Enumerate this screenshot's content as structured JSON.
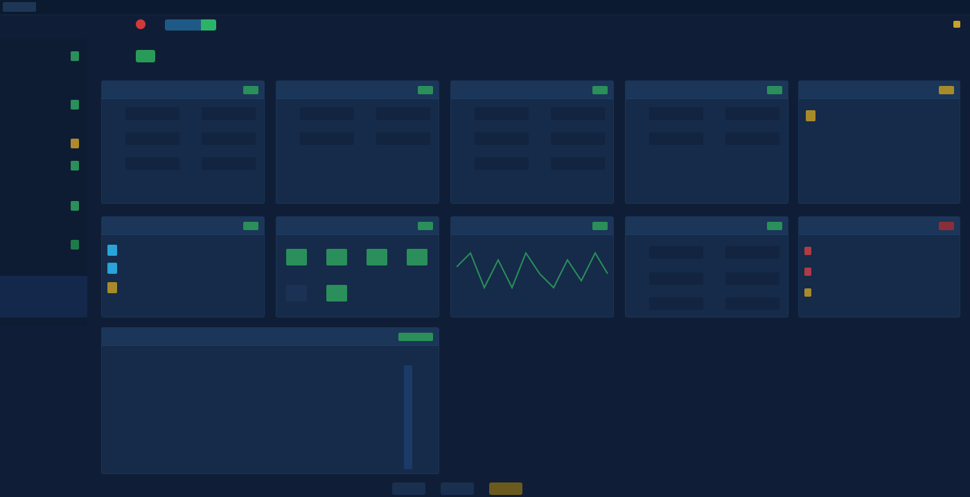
{
  "app": {
    "brand": "",
    "nav": [
      "",
      "",
      ""
    ],
    "top_right": [
      "",
      "",
      ""
    ]
  },
  "subbar": {
    "label_1": "",
    "label_2": "",
    "live_label": ""
  },
  "sidebar": {
    "items": [
      {
        "label": "",
        "sub": ""
      },
      {
        "label": "",
        "sub": ""
      },
      {
        "label": "",
        "sub": ""
      },
      {
        "label": "",
        "sub": ""
      },
      {
        "label": "",
        "sub": ""
      },
      {
        "label": "",
        "sub": ""
      },
      {
        "label": "",
        "sub": ""
      }
    ],
    "active_label": ""
  },
  "page": {
    "title": "",
    "title_badge": "",
    "header_right": ""
  },
  "panels_row1": [
    {
      "title": "",
      "fields": [
        "",
        "",
        "",
        "",
        "",
        ""
      ]
    },
    {
      "title": "",
      "fields": [
        "",
        "",
        "",
        ""
      ]
    },
    {
      "title": "",
      "fields": [
        "",
        "",
        "",
        "",
        "",
        ""
      ]
    },
    {
      "title": "",
      "fields": [
        "",
        "",
        "",
        ""
      ]
    },
    {
      "title": "",
      "rows": [
        "",
        "",
        "",
        ""
      ]
    }
  ],
  "panels_row2": [
    {
      "title": "",
      "rows": [
        {
          "label": "",
          "value": ""
        },
        {
          "label": "",
          "value": ""
        },
        {
          "label": "",
          "value": ""
        }
      ]
    },
    {
      "title": ""
    },
    {
      "title": ""
    },
    {
      "title": "",
      "fields": [
        "",
        "",
        "",
        "",
        "",
        ""
      ]
    },
    {
      "title": "",
      "alarms": [
        {
          "text": "",
          "value": ""
        },
        {
          "text": "",
          "value": ""
        },
        {
          "text": "",
          "value": ""
        }
      ]
    }
  ],
  "bottom_panel": {
    "title": "",
    "rows": [
      "",
      "",
      "",
      "",
      "",
      ""
    ]
  },
  "footer": {
    "buttons": [
      "",
      "",
      ""
    ]
  },
  "colors": {
    "background": "#0f1e36",
    "panel": "#152b49",
    "accent_green": "#2a8f5a",
    "accent_blue": "#29a3d8",
    "accent_amber": "#c9a12a",
    "alert_red": "#d23a3a"
  }
}
